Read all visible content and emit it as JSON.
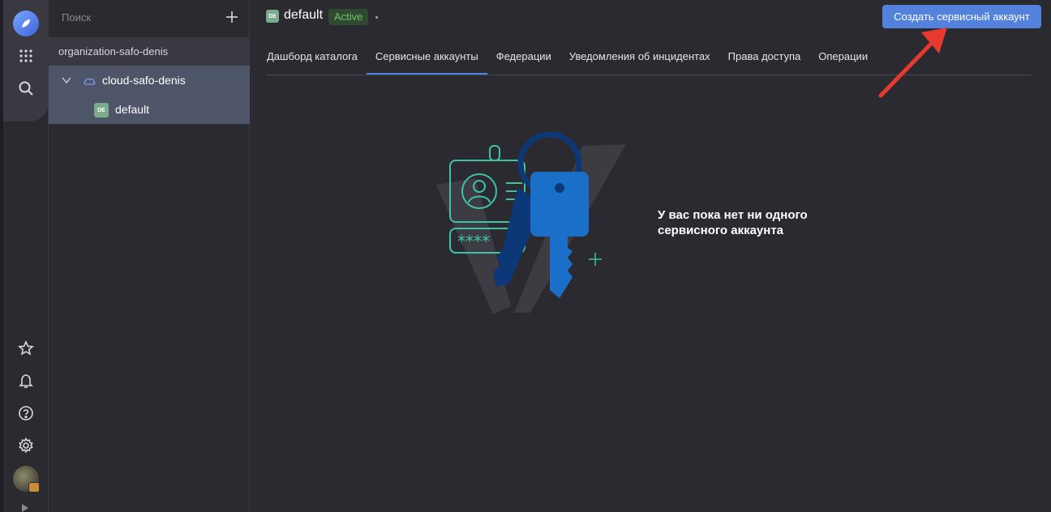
{
  "sidebar_tree": {
    "search_placeholder": "Поиск",
    "organization": "organization-safo-denis",
    "cloud": "cloud-safo-denis",
    "folder_badge": "DE",
    "folder": "default"
  },
  "header": {
    "badge": "DE",
    "title": "default",
    "status": "Active",
    "create_button": "Создать сервисный аккаунт"
  },
  "tabs": [
    {
      "label": "Дашборд каталога",
      "active": false
    },
    {
      "label": "Сервисные аккаунты",
      "active": true
    },
    {
      "label": "Федерации",
      "active": false
    },
    {
      "label": "Уведомления об инцидентах",
      "active": false
    },
    {
      "label": "Права доступа",
      "active": false
    },
    {
      "label": "Операции",
      "active": false
    }
  ],
  "empty_state": {
    "line1": "У вас пока нет ни одного",
    "line2": "сервисного аккаунта"
  },
  "colors": {
    "accent": "#5282dc",
    "status_green": "#6bc36b",
    "annotation_arrow": "#e8392f"
  }
}
